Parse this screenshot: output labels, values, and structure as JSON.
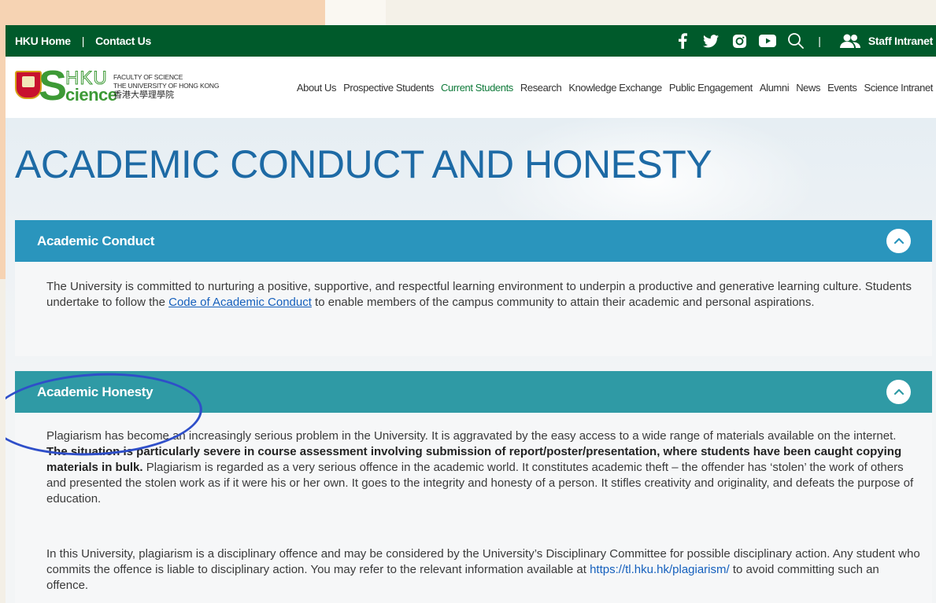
{
  "topbar": {
    "hku_home": "HKU Home",
    "separator": "|",
    "contact_us": "Contact Us",
    "icons": [
      "facebook-icon",
      "twitter-icon",
      "instagram-icon",
      "youtube-icon",
      "search-icon"
    ],
    "staff_intranet": "Staff Intranet"
  },
  "logo": {
    "letter_s": "S",
    "hku": "HKU",
    "cience": "cience",
    "faculty_line1": "FACULTY OF SCIENCE",
    "faculty_line2": "THE UNIVERSITY OF HONG KONG",
    "chinese_name": "香港大學理學院"
  },
  "nav": {
    "items": [
      "About Us",
      "Prospective Students",
      "Current Students",
      "Research",
      "Knowledge Exchange",
      "Public Engagement",
      "Alumni",
      "News",
      "Events",
      "Science Intranet"
    ],
    "active": "Current Students"
  },
  "page": {
    "title": "ACADEMIC CONDUCT AND HONESTY"
  },
  "sections": [
    {
      "heading": "Academic Conduct",
      "para_before_link": "The University is committed to nurturing a positive, supportive, and respectful learning environment to underpin a productive and generative learning culture. Students undertake to follow the ",
      "link_text": "Code of Academic Conduct",
      "para_after_link": " to enable members of the campus community to attain their academic and personal aspirations."
    },
    {
      "heading": "Academic Honesty",
      "p1_start": "Plagiarism has become an increasingly serious problem in the University.  It is aggravated by the easy access to a wide range of materials available on the internet.  ",
      "p1_bold": "The situation is particularly severe in course assessment involving submission of report/poster/presentation, where students have been caught copying materials in bulk.",
      "p1_end": "  Plagiarism is regarded as a very serious offence in the academic world.  It constitutes academic theft – the offender has ‘stolen’ the work of others and presented the stolen work as if it were his or her own.  It goes to the integrity and honesty of a person.  It stifles creativity and originality, and defeats the purpose of education.",
      "p2_start": "In this University, plagiarism is a disciplinary offence and may be considered by the University’s Disciplinary Committee for possible disciplinary action.  Any student who commits the offence is liable to disciplinary action.  You may refer to the relevant information available at ",
      "p2_link": "https://tl.hku.hk/plagiarism/",
      "p2_end": " to avoid committing such an offence."
    }
  ],
  "colors": {
    "topbar": "#005a2b",
    "panel_conduct": "#2a95bd",
    "panel_honesty": "#2f9aa5",
    "title": "#1d6aa5",
    "annotation": "#2f4fc9"
  }
}
